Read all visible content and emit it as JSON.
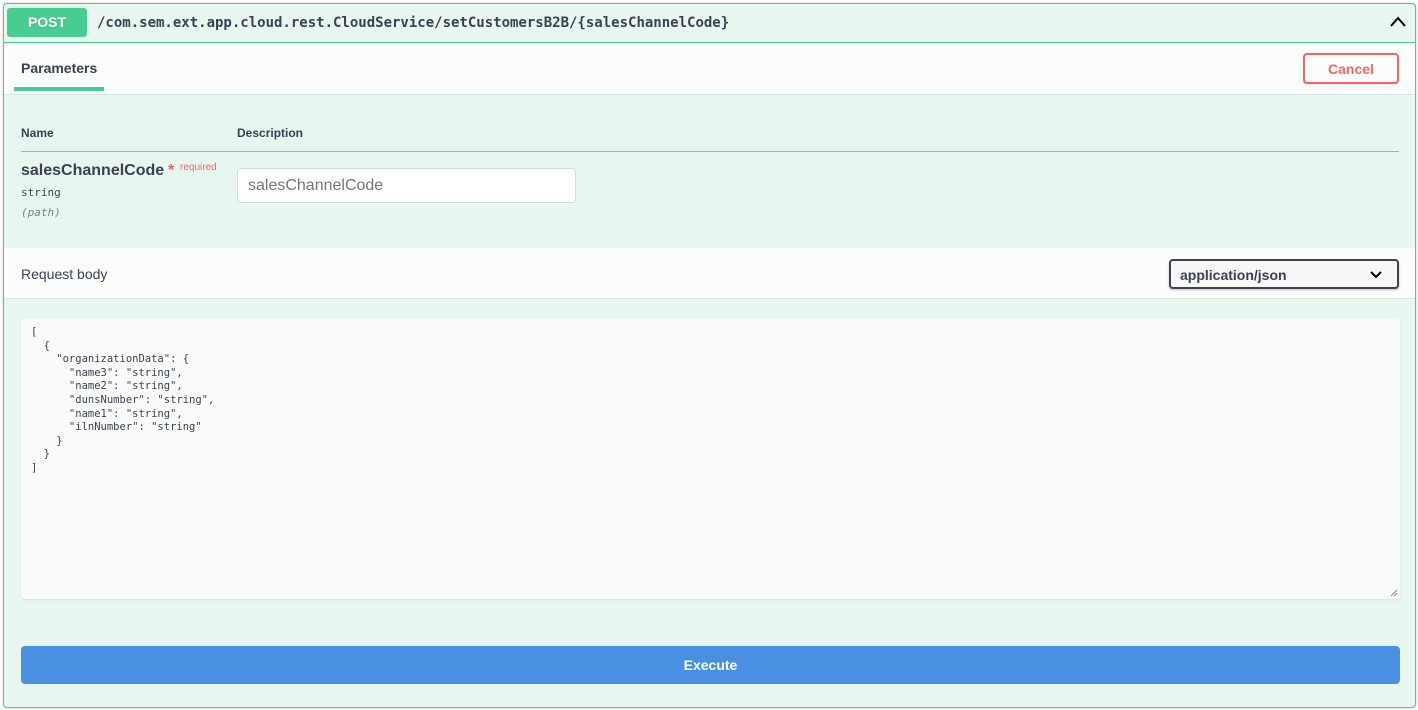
{
  "operation": {
    "method": "POST",
    "path": "/com.sem.ext.app.cloud.rest.CloudService/setCustomersB2B/{salesChannelCode}",
    "collapse_icon": "chevron-up-icon"
  },
  "tabs": {
    "parameters_label": "Parameters",
    "cancel_label": "Cancel"
  },
  "parameters_table": {
    "col_name": "Name",
    "col_description": "Description",
    "rows": [
      {
        "name": "salesChannelCode",
        "required_mark": "*",
        "required_label": "required",
        "type": "string",
        "location": "(path)",
        "input_value": "",
        "input_placeholder": "salesChannelCode"
      }
    ]
  },
  "request_body": {
    "title": "Request body",
    "content_type": "application/json",
    "dropdown_icon": "chevron-down-icon",
    "example": "[\n  {\n    \"organizationData\": {\n      \"name3\": \"string\",\n      \"name2\": \"string\",\n      \"dunsNumber\": \"string\",\n      \"name1\": \"string\",\n      \"ilnNumber\": \"string\"\n    }\n  }\n]"
  },
  "actions": {
    "execute_label": "Execute"
  },
  "colors": {
    "post_accent": "#49cc90",
    "post_background": "#e8f6f0",
    "cancel": "#ff6060",
    "execute": "#4990e2",
    "text": "#3b4151"
  }
}
